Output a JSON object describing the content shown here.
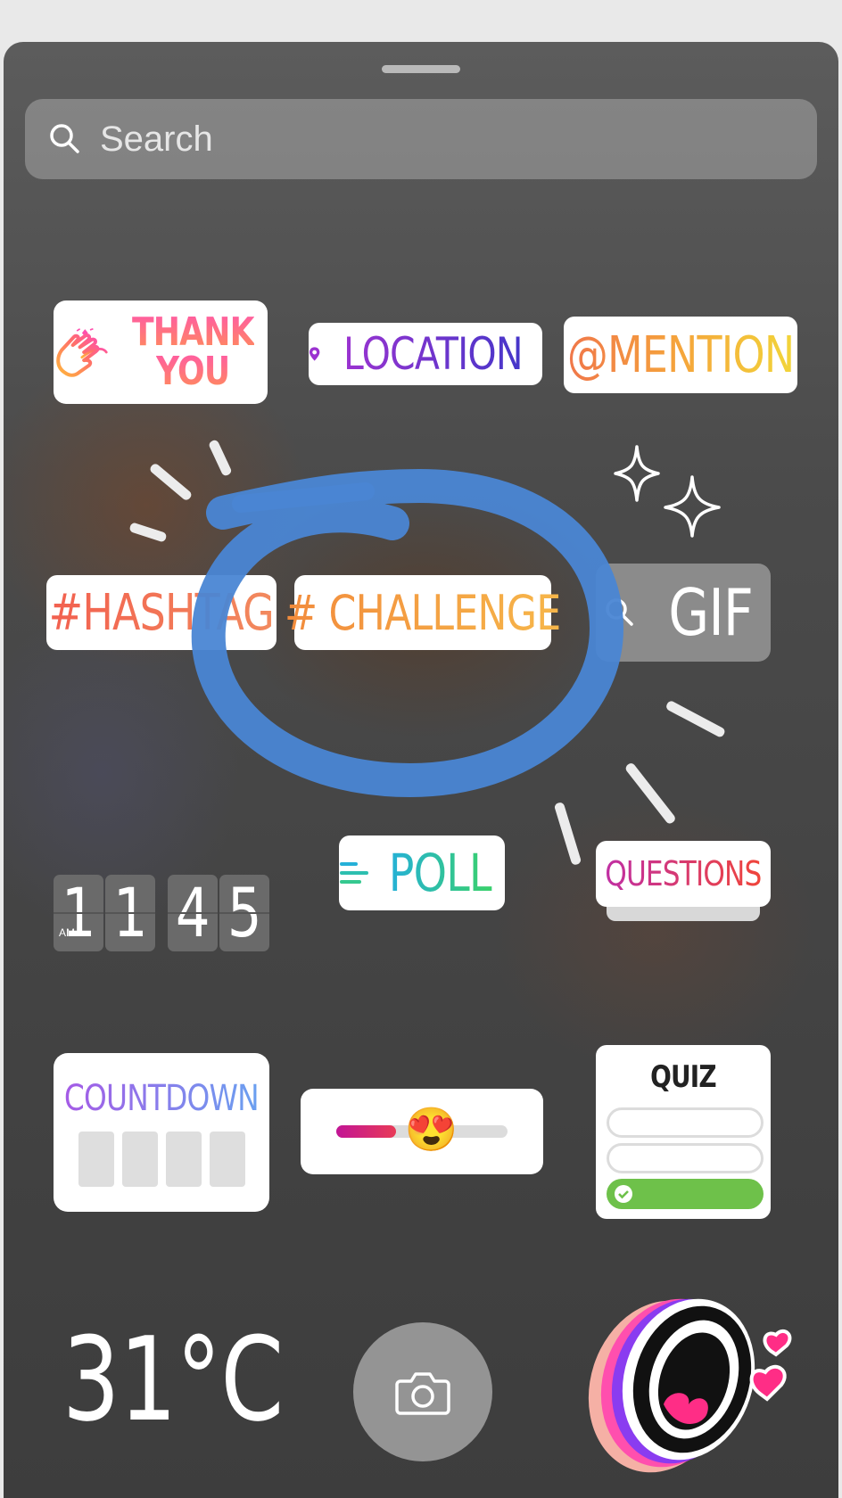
{
  "search": {
    "placeholder": "Search"
  },
  "stickers": {
    "thank_you": {
      "line1": "THANK",
      "line2": "YOU"
    },
    "location": "LOCATION",
    "mention": "@MENTION",
    "hashtag": "#HASHTAG",
    "challenge": "# CHALLENGE",
    "gif": "GIF",
    "time": {
      "ampm": "AM",
      "d1": "1",
      "d2": "1",
      "d3": "4",
      "d4": "5"
    },
    "poll": "POLL",
    "questions": "QUESTIONS",
    "countdown": "COUNTDOWN",
    "slider": {
      "emoji": "😍",
      "value": 0.35
    },
    "quiz": "QUIZ",
    "temperature": "31°C"
  },
  "icons": [
    "search-icon",
    "location-pin-icon",
    "clapping-hands-icon",
    "poll-lines-icon",
    "check-icon",
    "camera-icon",
    "screaming-mouth-icon",
    "hearts-icon"
  ],
  "colors": {
    "annotation_circle": "#4a86d4",
    "slider_fill": "#c21595",
    "quiz_correct": "#6ec14a"
  }
}
